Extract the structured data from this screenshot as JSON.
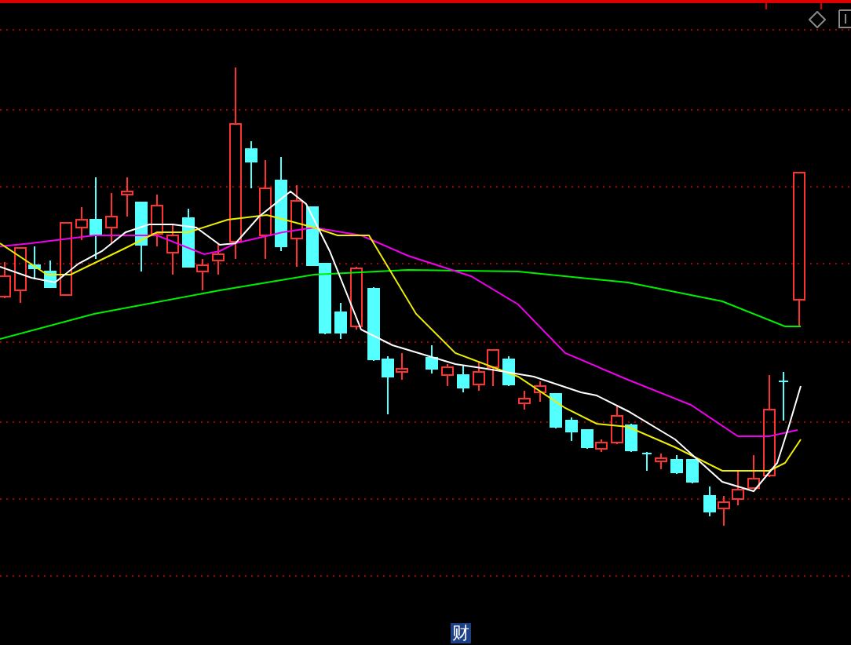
{
  "bottom_tab": {
    "label": "财"
  }
}
